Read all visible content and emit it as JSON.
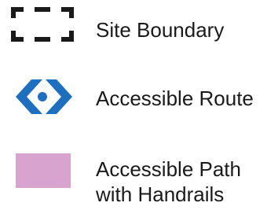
{
  "legend": {
    "items": [
      {
        "key": "site_boundary",
        "label": "Site Boundary",
        "icon": "dashed-rectangle-icon",
        "color": "#1a1a1a"
      },
      {
        "key": "accessible_route",
        "label": "Accessible Route",
        "icon": "double-chevron-route-icon",
        "color": "#1e6fbf"
      },
      {
        "key": "accessible_path_handrails",
        "label_line1": "Accessible Path",
        "label_line2": "with Handrails",
        "icon": "pink-fill-swatch-icon",
        "color": "#d8a3cf"
      }
    ]
  }
}
